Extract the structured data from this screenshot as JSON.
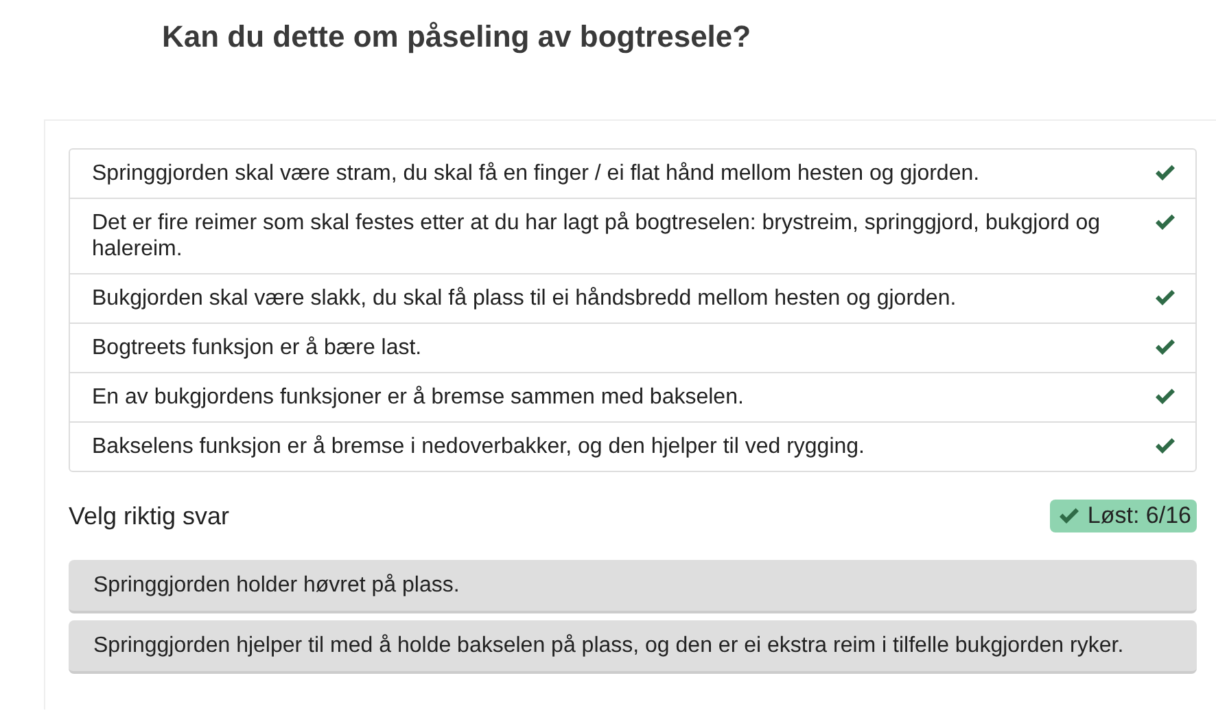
{
  "title": "Kan du dette om påseling av bogtresele?",
  "answered": [
    {
      "text": "Springgjorden skal være stram, du skal få en finger / ei flat hånd mellom hesten og gjorden.",
      "correct": true
    },
    {
      "text": "Det er fire reimer som skal festes etter at du har lagt på bogtreselen: brystreim, springgjord, bukgjord og halereim.",
      "correct": true
    },
    {
      "text": "Bukgjorden skal være slakk, du skal få plass til ei håndsbredd mellom hesten og gjorden.",
      "correct": true
    },
    {
      "text": "Bogtreets funksjon er å bære last.",
      "correct": true
    },
    {
      "text": "En av bukgjordens funksjoner er å bremse sammen med bakselen.",
      "correct": true
    },
    {
      "text": "Bakselens funksjon er å bremse i nedoverbakker, og den hjelper til ved rygging.",
      "correct": true
    }
  ],
  "prompt": "Velg riktig svar",
  "progress_badge": "Løst: 6/16",
  "options": [
    {
      "text": "Springgjorden holder høvret på plass."
    },
    {
      "text": "Springgjorden hjelper til med å holde bakselen på plass, og den er ei ekstra reim i tilfelle bukgjorden ryker."
    }
  ]
}
